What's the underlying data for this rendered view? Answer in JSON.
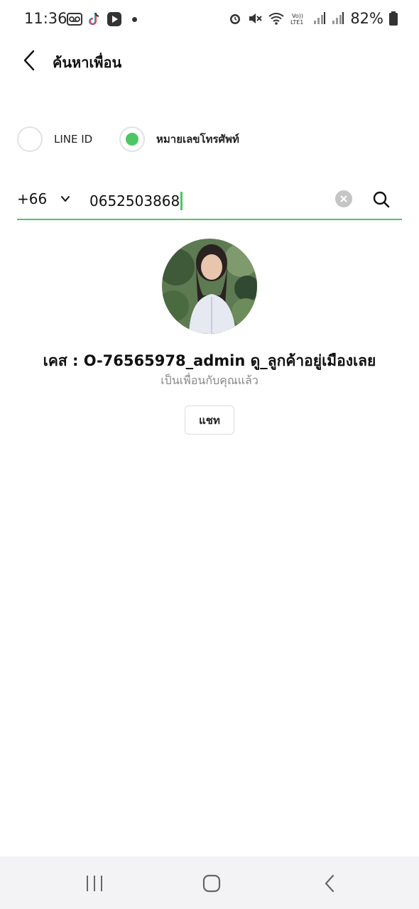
{
  "status_bar": {
    "time": "11:36",
    "battery_percent": "82%"
  },
  "header": {
    "title": "ค้นหาเพื่อน"
  },
  "search_type": {
    "options": [
      {
        "label": "LINE ID",
        "selected": false
      },
      {
        "label": "หมายเลขโทรศัพท์",
        "selected": true
      }
    ]
  },
  "search": {
    "country_code": "+66",
    "phone_value": "0652503868"
  },
  "result": {
    "name": "เคส : O-76565978_admin ดู_ลูกค้าอยู่เมืองเลย",
    "status": "เป็นเพื่อนกับคุณแล้ว",
    "chat_button_label": "แชท"
  },
  "colors": {
    "accent": "#4cc764"
  },
  "icons": {
    "back": "chevron-left-icon",
    "search": "search-icon",
    "clear": "clear-icon",
    "dropdown": "chevron-down-icon"
  }
}
